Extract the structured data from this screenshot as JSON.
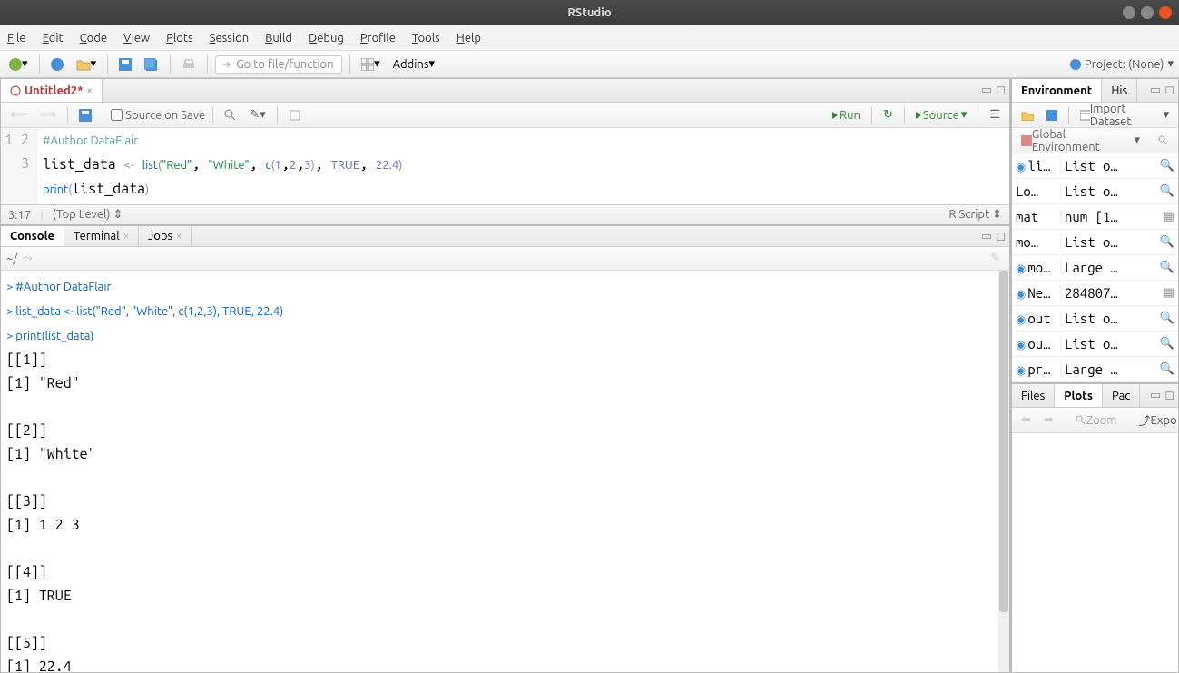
{
  "window": {
    "title": "RStudio"
  },
  "menu": [
    "File",
    "Edit",
    "Code",
    "View",
    "Plots",
    "Session",
    "Build",
    "Debug",
    "Profile",
    "Tools",
    "Help"
  ],
  "toolbar": {
    "goto_placeholder": "Go to file/function",
    "addins": "Addins",
    "project_label": "Project: (None)"
  },
  "editor": {
    "tab": "Untitled2*",
    "source_on_save": "Source on Save",
    "run": "Run",
    "source_btn": "Source",
    "cursor": "3:17",
    "scope": "(Top Level)",
    "filetype": "R Script",
    "lines": [
      {
        "n": "1",
        "tokens": [
          {
            "t": "#Author DataFlair",
            "c": "cmt"
          }
        ]
      },
      {
        "n": "2",
        "tokens": [
          {
            "t": "list_data ",
            "c": ""
          },
          {
            "t": "<-",
            "c": "op"
          },
          {
            "t": " ",
            "c": ""
          },
          {
            "t": "list",
            "c": "kw"
          },
          {
            "t": "(",
            "c": "paren"
          },
          {
            "t": "\"Red\"",
            "c": "str"
          },
          {
            "t": ", ",
            "c": ""
          },
          {
            "t": "\"White\"",
            "c": "str"
          },
          {
            "t": ", ",
            "c": ""
          },
          {
            "t": "c",
            "c": "kw"
          },
          {
            "t": "(",
            "c": "paren"
          },
          {
            "t": "1",
            "c": "num"
          },
          {
            "t": ",",
            "c": ""
          },
          {
            "t": "2",
            "c": "num"
          },
          {
            "t": ",",
            "c": ""
          },
          {
            "t": "3",
            "c": "num"
          },
          {
            "t": ")",
            "c": "paren"
          },
          {
            "t": ", ",
            "c": ""
          },
          {
            "t": "TRUE",
            "c": "const"
          },
          {
            "t": ", ",
            "c": ""
          },
          {
            "t": "22.4",
            "c": "num"
          },
          {
            "t": ")",
            "c": "paren"
          }
        ]
      },
      {
        "n": "3",
        "tokens": [
          {
            "t": "print",
            "c": "kw"
          },
          {
            "t": "(",
            "c": "paren"
          },
          {
            "t": "list_data",
            "c": ""
          },
          {
            "t": ")",
            "c": "paren"
          }
        ]
      }
    ]
  },
  "console": {
    "tabs": [
      "Console",
      "Terminal",
      "Jobs"
    ],
    "path": "~/",
    "lines": [
      {
        "prompt": "> ",
        "text": "#Author DataFlair",
        "c": "prompt"
      },
      {
        "prompt": "> ",
        "text": "list_data <- list(\"Red\", \"White\", c(1,2,3), TRUE, 22.4)",
        "c": "prompt"
      },
      {
        "prompt": "> ",
        "text": "print(list_data)",
        "c": "prompt"
      },
      {
        "prompt": "",
        "text": "[[1]]",
        "c": ""
      },
      {
        "prompt": "",
        "text": "[1] \"Red\"",
        "c": ""
      },
      {
        "prompt": "",
        "text": "",
        "c": ""
      },
      {
        "prompt": "",
        "text": "[[2]]",
        "c": ""
      },
      {
        "prompt": "",
        "text": "[1] \"White\"",
        "c": ""
      },
      {
        "prompt": "",
        "text": "",
        "c": ""
      },
      {
        "prompt": "",
        "text": "[[3]]",
        "c": ""
      },
      {
        "prompt": "",
        "text": "[1] 1 2 3",
        "c": ""
      },
      {
        "prompt": "",
        "text": "",
        "c": ""
      },
      {
        "prompt": "",
        "text": "[[4]]",
        "c": ""
      },
      {
        "prompt": "",
        "text": "[1] TRUE",
        "c": ""
      },
      {
        "prompt": "",
        "text": "",
        "c": ""
      },
      {
        "prompt": "",
        "text": "[[5]]",
        "c": ""
      },
      {
        "prompt": "",
        "text": "[1] 22.4",
        "c": ""
      }
    ]
  },
  "env": {
    "tabs": [
      "Environment",
      "His"
    ],
    "import": "Import Dataset",
    "scope": "Global Environment",
    "rows": [
      {
        "dot": true,
        "name": "li…",
        "value": "List o…",
        "mag": true
      },
      {
        "dot": false,
        "name": "Lo…",
        "value": "List o…",
        "mag": true
      },
      {
        "dot": false,
        "name": "mat",
        "value": "num [1…",
        "mag": false
      },
      {
        "dot": false,
        "name": "mo…",
        "value": "List o…",
        "mag": true
      },
      {
        "dot": true,
        "name": "mo…",
        "value": "Large …",
        "mag": true
      },
      {
        "dot": true,
        "name": "Ne…",
        "value": "284807…",
        "mag": false
      },
      {
        "dot": true,
        "name": "out",
        "value": "List o…",
        "mag": true
      },
      {
        "dot": true,
        "name": "ou…",
        "value": "List o…",
        "mag": true
      },
      {
        "dot": true,
        "name": "pr…",
        "value": "Large …",
        "mag": true
      }
    ]
  },
  "plots": {
    "tabs": [
      "Files",
      "Plots",
      "Pac"
    ],
    "zoom": "Zoom",
    "export": "Expo"
  }
}
